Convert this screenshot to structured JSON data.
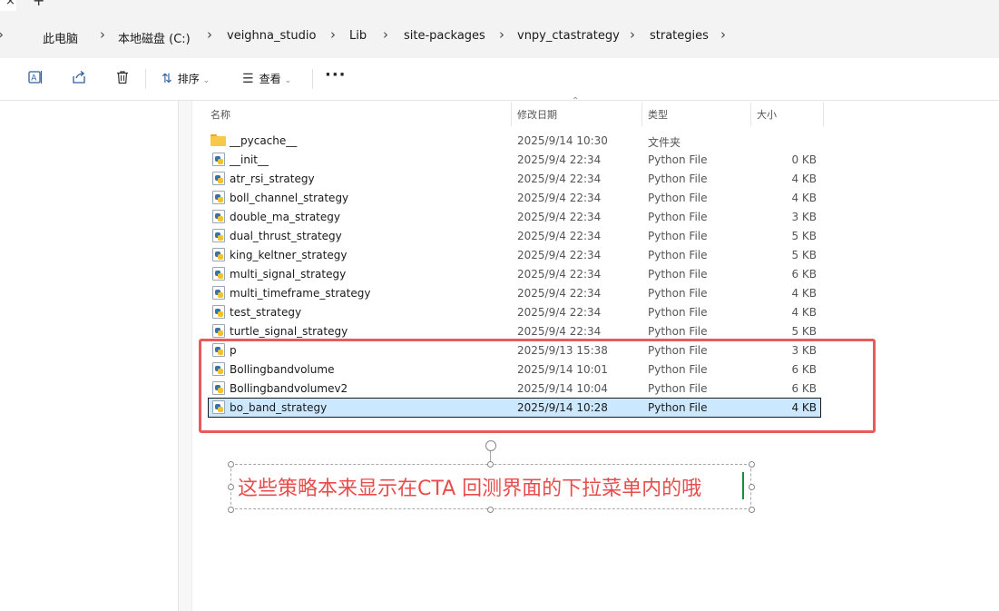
{
  "tab_strip": {
    "close_glyph": "×",
    "new_tab_glyph": "+"
  },
  "breadcrumb": [
    "此电脑",
    "本地磁盘 (C:)",
    "veighna_studio",
    "Lib",
    "site-packages",
    "vnpy_ctastrategy",
    "strategies"
  ],
  "toolbar": {
    "sort_label": "排序",
    "view_label": "查看",
    "more_label": "···",
    "icons": [
      "rename-icon",
      "share-icon",
      "delete-icon",
      "sort-icon",
      "view-icon"
    ]
  },
  "columns": {
    "name": "名称",
    "date": "修改日期",
    "type": "类型",
    "size": "大小"
  },
  "files": [
    {
      "name": "__pycache__",
      "date": "2025/9/14 10:30",
      "type": "文件夹",
      "size": "",
      "kind": "folder"
    },
    {
      "name": "__init__",
      "date": "2025/9/4 22:34",
      "type": "Python File",
      "size": "0 KB",
      "kind": "python"
    },
    {
      "name": "atr_rsi_strategy",
      "date": "2025/9/4 22:34",
      "type": "Python File",
      "size": "4 KB",
      "kind": "python"
    },
    {
      "name": "boll_channel_strategy",
      "date": "2025/9/4 22:34",
      "type": "Python File",
      "size": "4 KB",
      "kind": "python"
    },
    {
      "name": "double_ma_strategy",
      "date": "2025/9/4 22:34",
      "type": "Python File",
      "size": "3 KB",
      "kind": "python"
    },
    {
      "name": "dual_thrust_strategy",
      "date": "2025/9/4 22:34",
      "type": "Python File",
      "size": "5 KB",
      "kind": "python"
    },
    {
      "name": "king_keltner_strategy",
      "date": "2025/9/4 22:34",
      "type": "Python File",
      "size": "5 KB",
      "kind": "python"
    },
    {
      "name": "multi_signal_strategy",
      "date": "2025/9/4 22:34",
      "type": "Python File",
      "size": "6 KB",
      "kind": "python"
    },
    {
      "name": "multi_timeframe_strategy",
      "date": "2025/9/4 22:34",
      "type": "Python File",
      "size": "4 KB",
      "kind": "python"
    },
    {
      "name": "test_strategy",
      "date": "2025/9/4 22:34",
      "type": "Python File",
      "size": "4 KB",
      "kind": "python"
    },
    {
      "name": "turtle_signal_strategy",
      "date": "2025/9/4 22:34",
      "type": "Python File",
      "size": "5 KB",
      "kind": "python"
    },
    {
      "name": "p",
      "date": "2025/9/13 15:38",
      "type": "Python File",
      "size": "3 KB",
      "kind": "python"
    },
    {
      "name": "Bollingbandvolume",
      "date": "2025/9/14 10:01",
      "type": "Python File",
      "size": "6 KB",
      "kind": "python"
    },
    {
      "name": "Bollingbandvolumev2",
      "date": "2025/9/14 10:04",
      "type": "Python File",
      "size": "6 KB",
      "kind": "python"
    },
    {
      "name": "bo_band_strategy",
      "date": "2025/9/14 10:28",
      "type": "Python File",
      "size": "4 KB",
      "kind": "python",
      "selected": true
    }
  ],
  "annotation": {
    "text": "这些策略本来显示在CTA 回测界面的下拉菜单内的哦",
    "color": "#ea4c4c",
    "box_color": "#ea5a5a"
  },
  "colors": {
    "accent_icon": "#2f5f9e",
    "selection": "#cce8ff"
  }
}
